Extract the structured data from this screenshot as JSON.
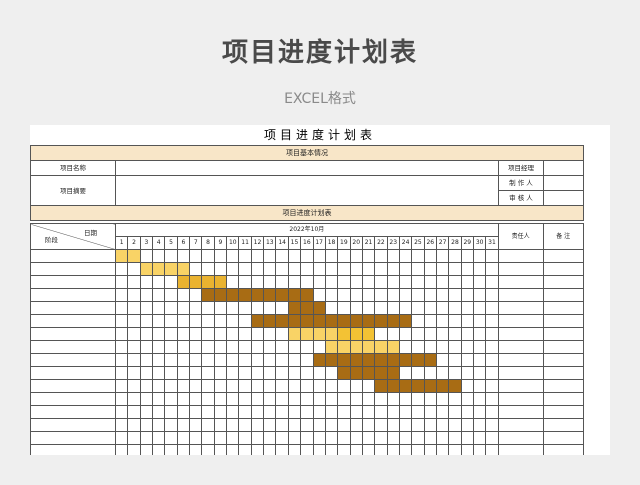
{
  "header": {
    "title": "项目进度计划表",
    "subtitle": "EXCEL格式"
  },
  "sheet": {
    "title": "项目进度计划表",
    "info_band": "项目基本情况",
    "fields": {
      "project_name": "项目名称",
      "project_summary": "项目摘要",
      "project_manager": "项目经理",
      "maker": "制 作 人",
      "reviewer": "审 核 人"
    },
    "schedule_band": "项目进度计划表",
    "date_label": "日期",
    "stage_label": "阶段",
    "month": "2022年10月",
    "responsible": "责任人",
    "remarks": "备 注",
    "days": [
      "1",
      "2",
      "3",
      "4",
      "5",
      "6",
      "7",
      "8",
      "9",
      "10",
      "11",
      "12",
      "13",
      "14",
      "15",
      "16",
      "17",
      "18",
      "19",
      "20",
      "21",
      "22",
      "23",
      "24",
      "25",
      "26",
      "27",
      "28",
      "29",
      "30",
      "31"
    ],
    "row_count": 16,
    "colors": {
      "light": "#f9d366",
      "yellow": "#f3c234",
      "gold": "#eab330",
      "brown": "#a86c14",
      "band": "#f8e6c8"
    },
    "bars": [
      {
        "row": 1,
        "segments": [
          {
            "start": 1,
            "end": 2,
            "color": "light"
          }
        ]
      },
      {
        "row": 2,
        "segments": [
          {
            "start": 3,
            "end": 6,
            "color": "light"
          }
        ]
      },
      {
        "row": 3,
        "segments": [
          {
            "start": 6,
            "end": 9,
            "color": "gold"
          }
        ]
      },
      {
        "row": 4,
        "segments": [
          {
            "start": 8,
            "end": 16,
            "color": "brown"
          }
        ]
      },
      {
        "row": 5,
        "segments": [
          {
            "start": 15,
            "end": 17,
            "color": "brown"
          }
        ]
      },
      {
        "row": 6,
        "segments": [
          {
            "start": 12,
            "end": 24,
            "color": "brown"
          }
        ]
      },
      {
        "row": 7,
        "segments": [
          {
            "start": 15,
            "end": 18,
            "color": "light"
          },
          {
            "start": 19,
            "end": 21,
            "color": "yellow"
          }
        ]
      },
      {
        "row": 8,
        "segments": [
          {
            "start": 18,
            "end": 23,
            "color": "light"
          }
        ]
      },
      {
        "row": 9,
        "segments": [
          {
            "start": 17,
            "end": 22,
            "color": "brown"
          },
          {
            "start": 23,
            "end": 26,
            "color": "brown"
          }
        ]
      },
      {
        "row": 10,
        "segments": [
          {
            "start": 19,
            "end": 23,
            "color": "brown"
          }
        ]
      },
      {
        "row": 11,
        "segments": [
          {
            "start": 22,
            "end": 28,
            "color": "brown"
          }
        ]
      }
    ]
  }
}
